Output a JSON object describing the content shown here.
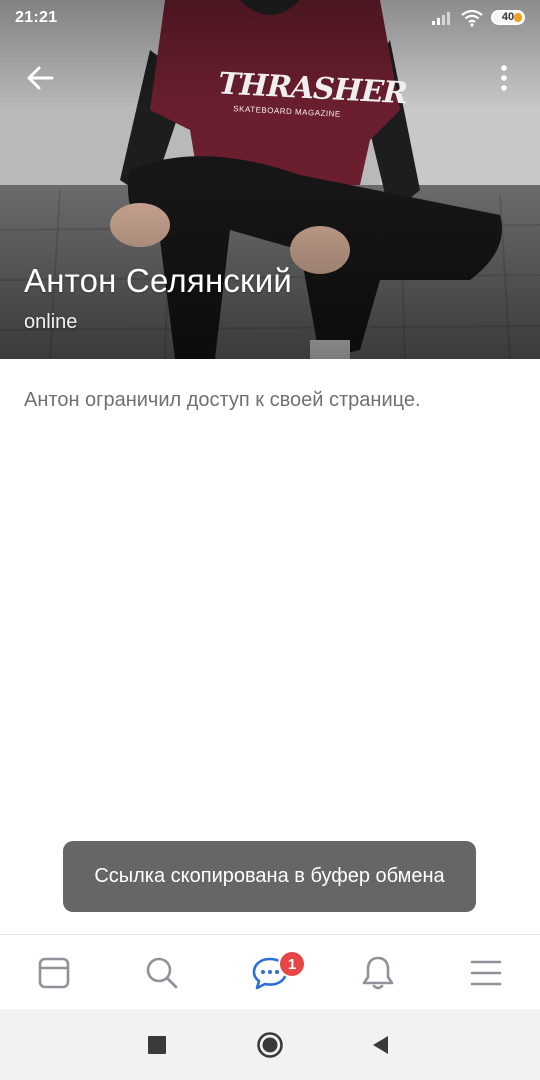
{
  "status_bar": {
    "time": "21:21",
    "battery_level": "40"
  },
  "profile": {
    "name": "Антон Селянский",
    "status": "online",
    "shirt_brand": "THRASHER",
    "shirt_sub": "SKATEBOARD MAGAZINE"
  },
  "content": {
    "restricted_message": "Антон ограничил доступ к своей странице."
  },
  "toast": {
    "message": "Ссылка скопирована в буфер обмена"
  },
  "tabbar": {
    "items": [
      {
        "icon": "news-icon",
        "active": false
      },
      {
        "icon": "search-icon",
        "active": false
      },
      {
        "icon": "messages-icon",
        "active": true
      },
      {
        "icon": "notifications-icon",
        "active": false
      },
      {
        "icon": "menu-icon",
        "active": false
      }
    ],
    "messages_badge": "1"
  },
  "system_nav": {
    "buttons": [
      "recents-icon",
      "home-icon",
      "back-icon"
    ]
  },
  "colors": {
    "accent": "#2a6fd6",
    "badge": "#e64646",
    "toast_bg": "#666666",
    "icon_gray": "#8f9399"
  }
}
